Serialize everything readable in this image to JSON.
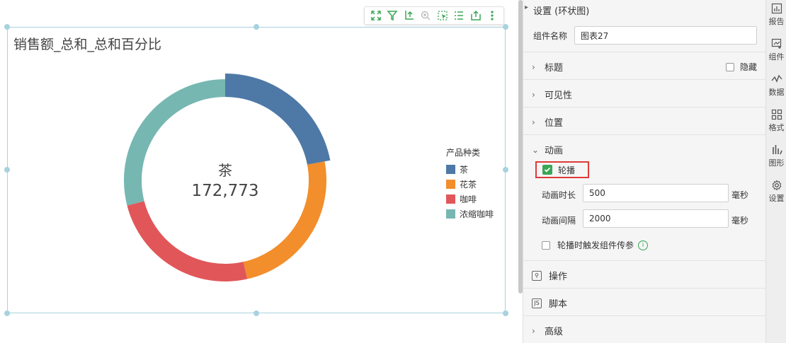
{
  "toolbar": {
    "icons": [
      "expand-icon",
      "filter-icon",
      "drill-icon",
      "zoom-icon",
      "select-icon",
      "list-icon",
      "export-icon",
      "more-icon"
    ]
  },
  "chart": {
    "title": "销售额_总和_总和百分比",
    "center_label": "茶",
    "center_value": "172,773",
    "legend_title": "产品种类"
  },
  "chart_data": {
    "type": "pie",
    "title": "销售额_总和_总和百分比",
    "categories": [
      "茶",
      "花茶",
      "咖啡",
      "浓缩咖啡"
    ],
    "percent": [
      22,
      24.5,
      24.5,
      29
    ],
    "values": [
      172773,
      null,
      null,
      null
    ],
    "highlighted": "茶",
    "colors": [
      "#4e79a7",
      "#f28e2b",
      "#e15759",
      "#76b7b2"
    ],
    "legend_position": "right"
  },
  "panel": {
    "header": "设置 (环状图)",
    "component_name_label": "组件名称",
    "component_name_value": "图表27",
    "sections": {
      "title": "标题",
      "hide": "隐藏",
      "visibility": "可见性",
      "position": "位置",
      "animation": "动画",
      "operation": "操作",
      "script": "脚本",
      "advanced": "高级"
    },
    "carousel_label": "轮播",
    "anim_duration_label": "动画时长",
    "anim_duration_value": "500",
    "anim_interval_label": "动画间隔",
    "anim_interval_value": "2000",
    "unit_ms": "毫秒",
    "trigger_label": "轮播时触发组件传参",
    "script_icon_text": "JS"
  },
  "sidebar": {
    "report": "报告",
    "component": "组件",
    "data": "数据",
    "format": "格式",
    "graphic": "图形",
    "settings": "设置"
  }
}
